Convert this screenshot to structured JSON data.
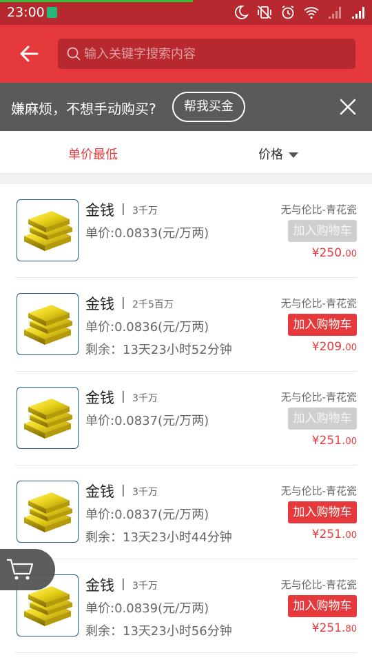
{
  "status": {
    "time": "23:00",
    "icons": [
      "moon-icon",
      "vibrate-off-icon",
      "alarm-icon",
      "wifi-icon",
      "signal-icon",
      "signal-icon"
    ]
  },
  "header": {
    "search_placeholder": "输入关键字搜索内容"
  },
  "promo": {
    "text": "嫌麻烦，不想手动购买?",
    "button": "帮我买金"
  },
  "sort": {
    "lowest": "单价最低",
    "price": "价格"
  },
  "items": [
    {
      "name": "金钱",
      "sep": "|",
      "qty": "3千万",
      "unit_price": "单价:0.0833(元/万两)",
      "remaining": "",
      "server": "无与伦比-青花瓷",
      "cart_label": "加入购物车",
      "cart_enabled": false,
      "price_main": "¥250.",
      "price_cents": "00"
    },
    {
      "name": "金钱",
      "sep": "|",
      "qty": "2千5百万",
      "unit_price": "单价:0.0836(元/万两)",
      "remaining": "剩余：13天23小时52分钟",
      "server": "无与伦比-青花瓷",
      "cart_label": "加入购物车",
      "cart_enabled": true,
      "price_main": "¥209.",
      "price_cents": "00"
    },
    {
      "name": "金钱",
      "sep": "|",
      "qty": "3千万",
      "unit_price": "单价:0.0837(元/万两)",
      "remaining": "",
      "server": "无与伦比-青花瓷",
      "cart_label": "加入购物车",
      "cart_enabled": false,
      "price_main": "¥251.",
      "price_cents": "00"
    },
    {
      "name": "金钱",
      "sep": "|",
      "qty": "3千万",
      "unit_price": "单价:0.0837(元/万两)",
      "remaining": "剩余：13天23小时44分钟",
      "server": "无与伦比-青花瓷",
      "cart_label": "加入购物车",
      "cart_enabled": true,
      "price_main": "¥251.",
      "price_cents": "00"
    },
    {
      "name": "金钱",
      "sep": "|",
      "qty": "3千万",
      "unit_price": "单价:0.0839(元/万两)",
      "remaining": "剩余：13天23小时56分钟",
      "server": "无与伦比-青花瓷",
      "cart_label": "加入购物车",
      "cart_enabled": true,
      "price_main": "¥251.",
      "price_cents": "80"
    }
  ],
  "colors": {
    "primary": "#e5393b",
    "header_dark": "#b8282f",
    "promo_bg": "#5a5a5a",
    "disabled": "#cfcfcf"
  }
}
